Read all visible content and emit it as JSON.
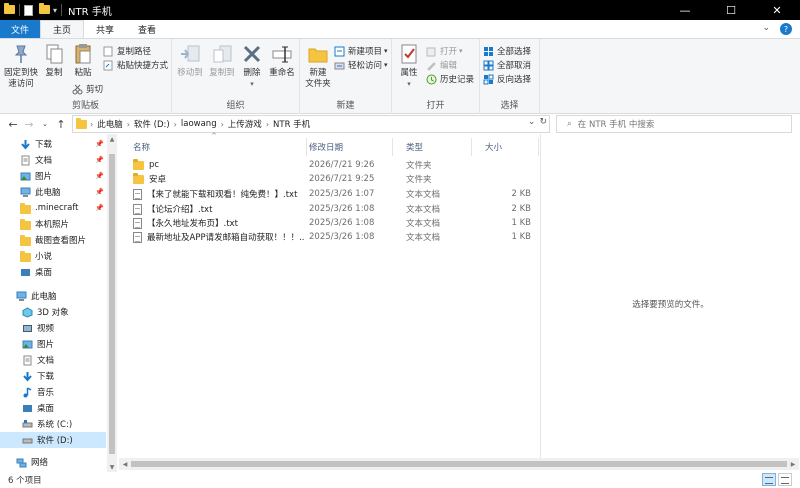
{
  "window": {
    "title": "NTR 手机",
    "minimize": "—",
    "maximize": "☐",
    "close": "✕"
  },
  "ribbon_tabs": [
    "文件",
    "主页",
    "共享",
    "查看"
  ],
  "ribbon": {
    "clipboard": {
      "label": "剪贴板",
      "pin": "固定到快\n速访问",
      "copy": "复制",
      "paste": "粘贴",
      "copy_path": "复制路径",
      "paste_shortcut": "粘贴快捷方式",
      "cut": "剪切"
    },
    "organize": {
      "label": "组织",
      "move_to": "移动到",
      "copy_to": "复制到",
      "delete": "删除",
      "rename": "重命名"
    },
    "new": {
      "label": "新建",
      "new_folder": "新建\n文件夹",
      "new_item": "新建项目",
      "easy_access": "轻松访问"
    },
    "open": {
      "label": "打开",
      "properties": "属性",
      "open": "打开",
      "edit": "编辑",
      "history": "历史记录"
    },
    "select": {
      "label": "选择",
      "select_all": "全部选择",
      "select_none": "全部取消",
      "invert": "反向选择"
    }
  },
  "address": {
    "crumbs": [
      "此电脑",
      "软件 (D:)",
      "laowang",
      "上传游戏",
      "NTR 手机"
    ],
    "search_placeholder": "在 NTR 手机 中搜索"
  },
  "nav": {
    "quick": [
      {
        "label": "下载",
        "icon": "download-icon",
        "pinned": true
      },
      {
        "label": "文档",
        "icon": "document-icon",
        "pinned": true
      },
      {
        "label": "图片",
        "icon": "picture-icon",
        "pinned": true
      },
      {
        "label": "此电脑",
        "icon": "computer-icon",
        "pinned": true
      },
      {
        "label": ".minecraft",
        "icon": "folder-icon",
        "pinned": true
      },
      {
        "label": "本机照片",
        "icon": "folder-icon",
        "pinned": false
      },
      {
        "label": "截图查看图片",
        "icon": "folder-icon",
        "pinned": false
      },
      {
        "label": "小说",
        "icon": "folder-icon",
        "pinned": false
      },
      {
        "label": "桌面",
        "icon": "desktop-icon",
        "pinned": false
      }
    ],
    "pc_label": "此电脑",
    "pc": [
      {
        "label": "3D 对象",
        "icon": "cube-icon"
      },
      {
        "label": "视频",
        "icon": "video-icon"
      },
      {
        "label": "图片",
        "icon": "picture-icon"
      },
      {
        "label": "文档",
        "icon": "document-icon"
      },
      {
        "label": "下载",
        "icon": "download-icon"
      },
      {
        "label": "音乐",
        "icon": "music-icon"
      },
      {
        "label": "桌面",
        "icon": "desktop-icon"
      },
      {
        "label": "系统 (C:)",
        "icon": "drive-icon"
      },
      {
        "label": "软件 (D:)",
        "icon": "drive-icon"
      }
    ],
    "network_label": "网络"
  },
  "columns": {
    "name": "名称",
    "date": "修改日期",
    "type": "类型",
    "size": "大小"
  },
  "files": [
    {
      "name": "pc",
      "date": "2026/7/21 9:26",
      "type": "文件夹",
      "size": "",
      "kind": "folder"
    },
    {
      "name": "安卓",
      "date": "2026/7/21 9:25",
      "type": "文件夹",
      "size": "",
      "kind": "folder"
    },
    {
      "name": "【来了就能下载和观看！纯免费！】.txt",
      "date": "2025/3/26 1:07",
      "type": "文本文档",
      "size": "2 KB",
      "kind": "txt"
    },
    {
      "name": "【论坛介绍】.txt",
      "date": "2025/3/26 1:08",
      "type": "文本文档",
      "size": "2 KB",
      "kind": "txt"
    },
    {
      "name": "【永久地址发布页】.txt",
      "date": "2025/3/26 1:08",
      "type": "文本文档",
      "size": "1 KB",
      "kind": "txt"
    },
    {
      "name": "最新地址及APP请发邮箱自动获取！！！....",
      "date": "2025/3/26 1:08",
      "type": "文本文档",
      "size": "1 KB",
      "kind": "txt"
    }
  ],
  "preview_message": "选择要预览的文件。",
  "status": {
    "count": "6 个项目"
  },
  "colors": {
    "accent": "#1979ca",
    "folder": "#f5c542",
    "selection": "#cce8ff"
  }
}
